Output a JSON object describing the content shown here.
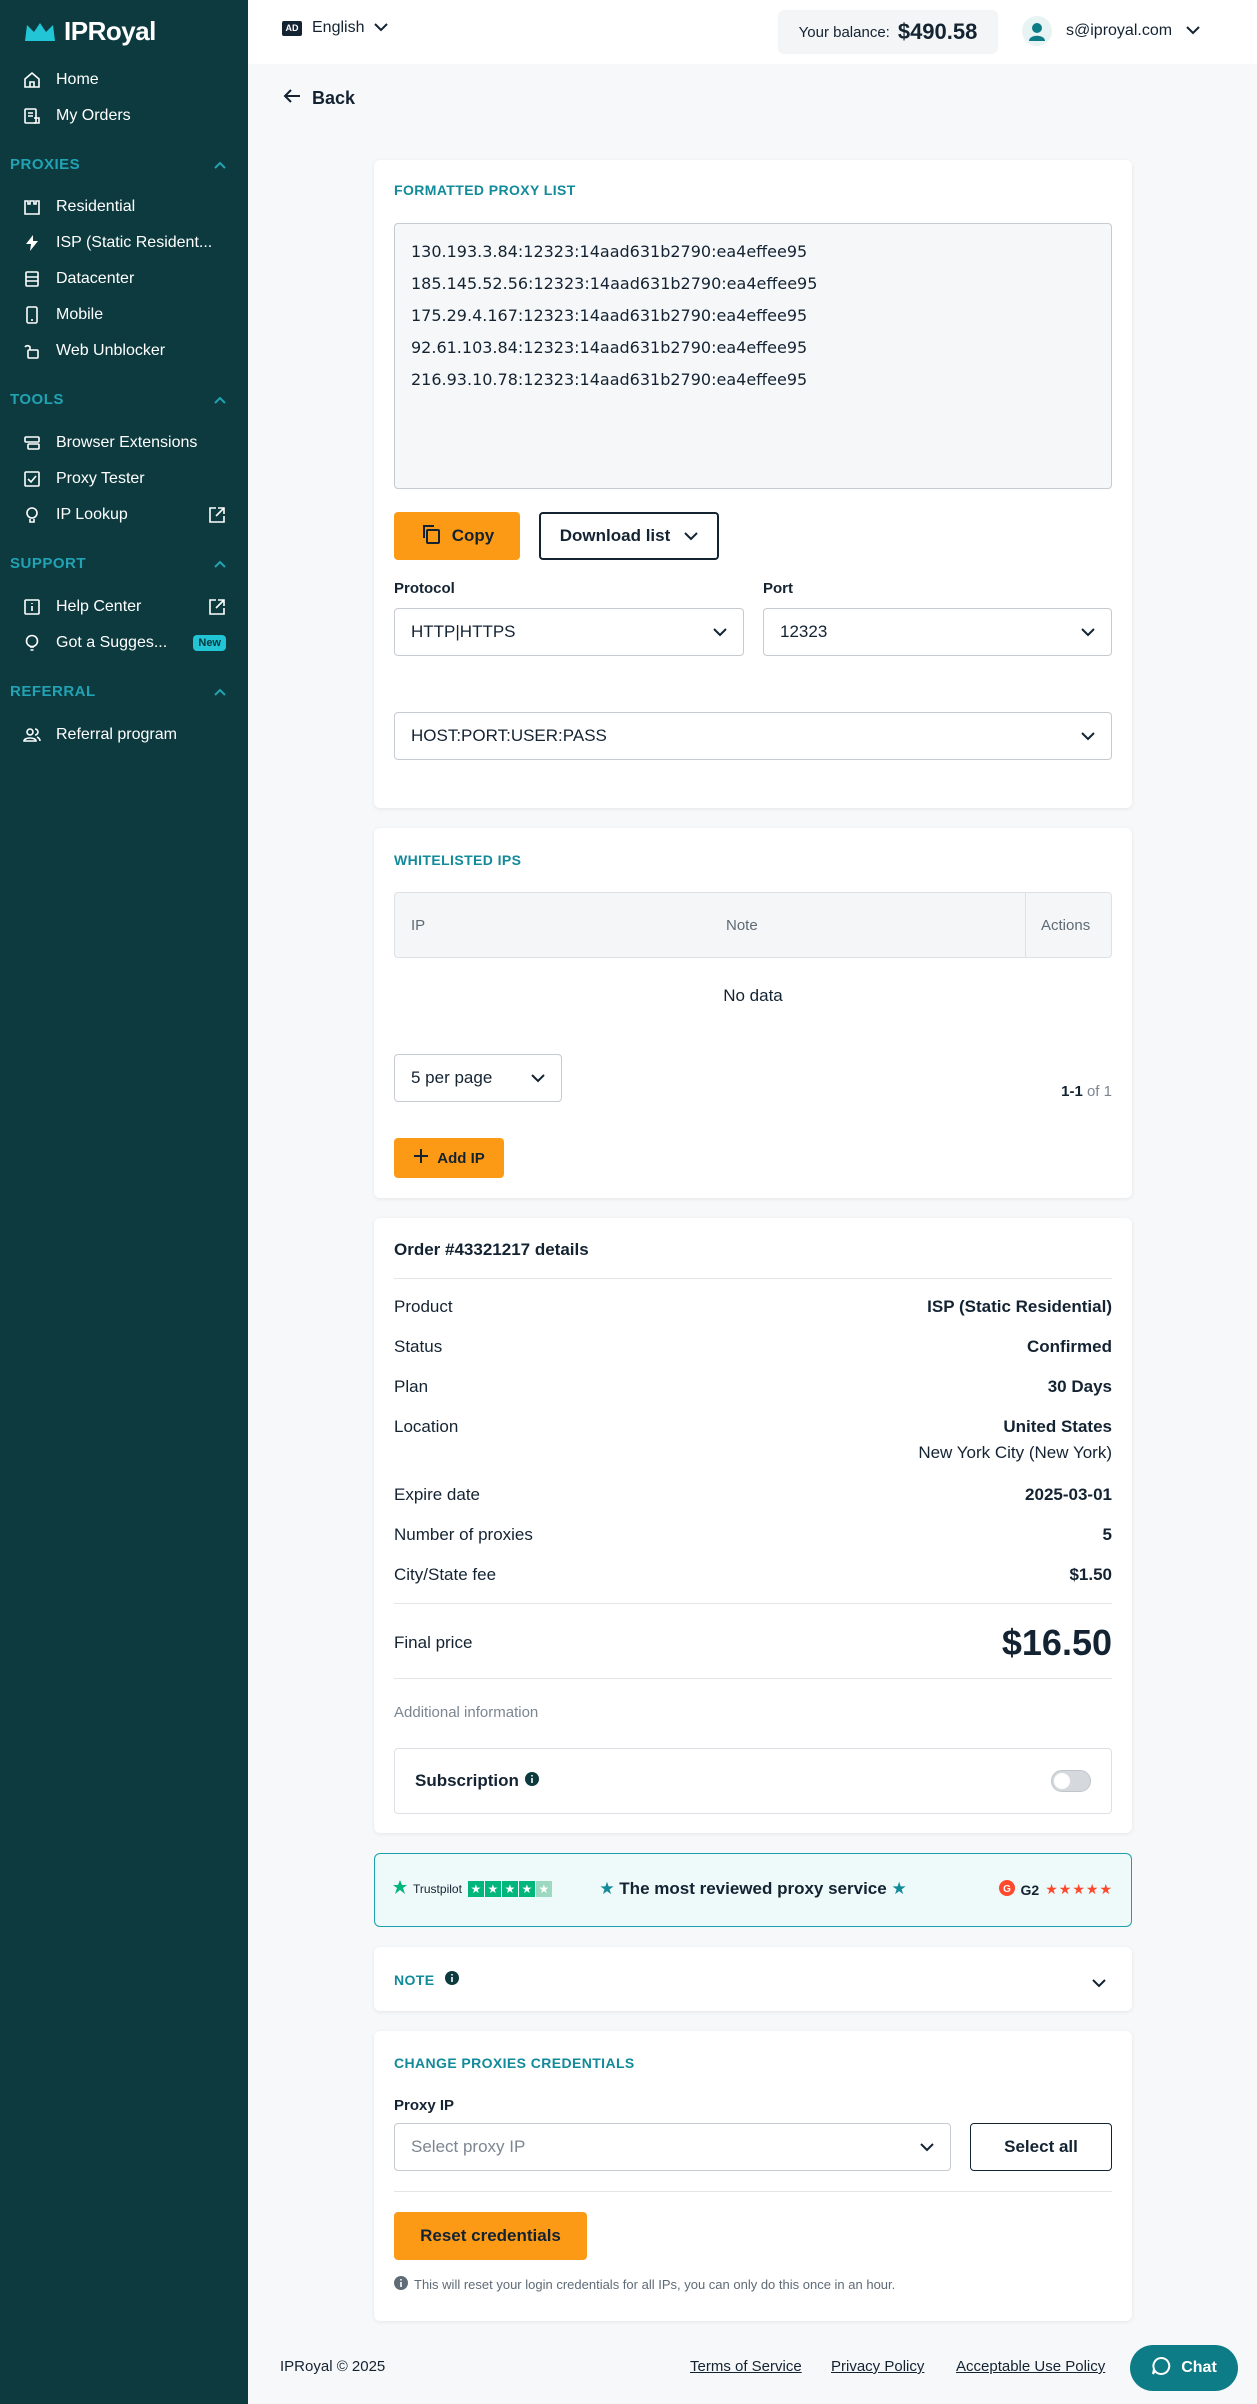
{
  "app": {
    "name": "IPRoyal"
  },
  "sidebar": {
    "top_items": [
      {
        "label": "Home",
        "icon": "home-icon"
      },
      {
        "label": "My Orders",
        "icon": "orders-icon"
      }
    ],
    "sections": {
      "proxies": {
        "title": "PROXIES",
        "items": [
          {
            "label": "Residential"
          },
          {
            "label": "ISP (Static Resident..."
          },
          {
            "label": "Datacenter"
          },
          {
            "label": "Mobile"
          },
          {
            "label": "Web Unblocker"
          }
        ]
      },
      "tools": {
        "title": "TOOLS",
        "items": [
          {
            "label": "Browser Extensions"
          },
          {
            "label": "Proxy Tester"
          },
          {
            "label": "IP Lookup"
          }
        ]
      },
      "support": {
        "title": "SUPPORT",
        "items": [
          {
            "label": "Help Center"
          },
          {
            "label": "Got a Sugges..."
          }
        ],
        "new_badge": "New"
      },
      "referral": {
        "title": "REFERRAL",
        "items": [
          {
            "label": "Referral program"
          }
        ]
      }
    }
  },
  "topbar": {
    "language": "English",
    "language_flag": "AD",
    "balance_label": "Your balance:",
    "balance_value": "$490.58",
    "user_email": "s@iproyal.com"
  },
  "back_label": "Back",
  "proxy_list": {
    "title": "FORMATTED PROXY LIST",
    "lines": [
      "130.193.3.84:12323:14aad631b2790:ea4effee95",
      "185.145.52.56:12323:14aad631b2790:ea4effee95",
      "175.29.4.167:12323:14aad631b2790:ea4effee95",
      "92.61.103.84:12323:14aad631b2790:ea4effee95",
      "216.93.10.78:12323:14aad631b2790:ea4effee95"
    ],
    "copy_label": "Copy",
    "download_label": "Download list",
    "protocol_label": "Protocol",
    "protocol_value": "HTTP|HTTPS",
    "port_label": "Port",
    "port_value": "12323",
    "format_value": "HOST:PORT:USER:PASS"
  },
  "whitelist": {
    "title": "WHITELISTED IPS",
    "columns": [
      "IP",
      "Note",
      "Actions"
    ],
    "empty_text": "No data",
    "per_page": "5 per page",
    "pagination_range": "1-1",
    "pagination_total": "of 1",
    "add_label": "Add IP"
  },
  "order": {
    "title": "Order #43321217 details",
    "rows": [
      {
        "key": "Product",
        "value": "ISP (Static Residential)"
      },
      {
        "key": "Status",
        "value": "Confirmed"
      },
      {
        "key": "Plan",
        "value": "30 Days"
      },
      {
        "key": "Location",
        "value": "United States",
        "value2": "New York City (New York)"
      },
      {
        "key": "Expire date",
        "value": "2025-03-01"
      },
      {
        "key": "Number of proxies",
        "value": "5"
      },
      {
        "key": "City/State fee",
        "value": "$1.50"
      }
    ],
    "final_label": "Final price",
    "final_value": "$16.50",
    "additional_info": "Additional information",
    "subscription_label": "Subscription",
    "subscription_on": false
  },
  "review_banner": {
    "left": "Trustpilot",
    "center": "The most reviewed proxy service",
    "right": "G2"
  },
  "note": {
    "title": "NOTE"
  },
  "credentials": {
    "title": "CHANGE PROXIES CREDENTIALS",
    "proxy_ip_label": "Proxy IP",
    "proxy_ip_placeholder": "Select proxy IP",
    "select_all_label": "Select all",
    "reset_label": "Reset credentials",
    "info_text": "This will reset your login credentials for all IPs, you can only do this once in an hour."
  },
  "footer": {
    "copyright": "IPRoyal © 2025",
    "links": [
      "Terms of Service",
      "Privacy Policy",
      "Acceptable Use Policy"
    ]
  },
  "chat_label": "Chat",
  "colors": {
    "sidebar": "#0c3a3e",
    "accent": "#fd9a15",
    "teal": "#118a9a"
  }
}
